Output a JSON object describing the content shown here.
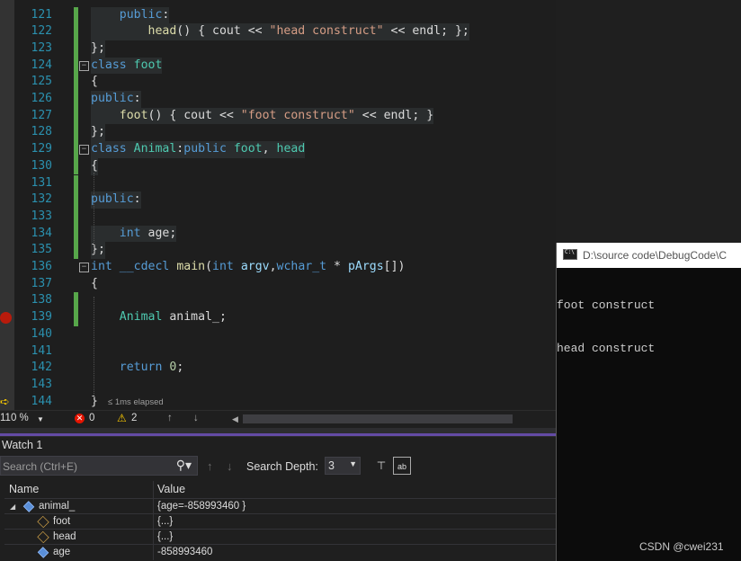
{
  "editor": {
    "lines": [
      {
        "n": "121",
        "t": [
          [
            "    ",
            ""
          ],
          [
            "public",
            "kw"
          ],
          [
            ":",
            ""
          ]
        ]
      },
      {
        "n": "122",
        "t": [
          [
            "        ",
            ""
          ],
          [
            "head",
            "fn"
          ],
          [
            "() { ",
            ""
          ],
          [
            "cout",
            "id"
          ],
          [
            " << ",
            ""
          ],
          [
            "\"head construct\"",
            "str"
          ],
          [
            " << ",
            ""
          ],
          [
            "endl",
            "id"
          ],
          [
            "; };",
            ""
          ]
        ]
      },
      {
        "n": "123",
        "t": [
          [
            "};",
            ""
          ]
        ]
      },
      {
        "n": "124",
        "t": [
          [
            "class",
            "kw"
          ],
          [
            " ",
            ""
          ],
          [
            "foot",
            "ty"
          ]
        ],
        "fold": "-"
      },
      {
        "n": "125",
        "t": [
          [
            "{",
            ""
          ]
        ]
      },
      {
        "n": "126",
        "t": [
          [
            "public",
            "kw"
          ],
          [
            ":",
            ""
          ]
        ]
      },
      {
        "n": "127",
        "t": [
          [
            "    ",
            ""
          ],
          [
            "foot",
            "fn"
          ],
          [
            "() { ",
            ""
          ],
          [
            "cout",
            "id"
          ],
          [
            " << ",
            ""
          ],
          [
            "\"foot construct\"",
            "str"
          ],
          [
            " << ",
            ""
          ],
          [
            "endl",
            "id"
          ],
          [
            "; }",
            ""
          ]
        ]
      },
      {
        "n": "128",
        "t": [
          [
            "};",
            ""
          ]
        ]
      },
      {
        "n": "129",
        "t": [
          [
            "class",
            "kw"
          ],
          [
            " ",
            ""
          ],
          [
            "Animal",
            "ty"
          ],
          [
            ":",
            ""
          ],
          [
            "public",
            "kw"
          ],
          [
            " ",
            ""
          ],
          [
            "foot",
            "ty"
          ],
          [
            ", ",
            ""
          ],
          [
            "head",
            "ty"
          ]
        ],
        "fold": "-"
      },
      {
        "n": "130",
        "t": [
          [
            "{",
            ""
          ]
        ]
      },
      {
        "n": "131",
        "t": [
          [
            "",
            ""
          ]
        ]
      },
      {
        "n": "132",
        "t": [
          [
            "public",
            "kw"
          ],
          [
            ":",
            ""
          ]
        ]
      },
      {
        "n": "133",
        "t": [
          [
            "",
            ""
          ]
        ]
      },
      {
        "n": "134",
        "t": [
          [
            "    ",
            ""
          ],
          [
            "int",
            "kw"
          ],
          [
            " ",
            ""
          ],
          [
            "age",
            "id"
          ],
          [
            ";",
            ""
          ]
        ]
      },
      {
        "n": "135",
        "t": [
          [
            "};",
            ""
          ]
        ]
      },
      {
        "n": "136",
        "t": [
          [
            "int",
            "kw"
          ],
          [
            " ",
            ""
          ],
          [
            "__cdecl",
            "kw"
          ],
          [
            " ",
            ""
          ],
          [
            "main",
            "fn"
          ],
          [
            "(",
            ""
          ],
          [
            "int",
            "kw"
          ],
          [
            " ",
            ""
          ],
          [
            "argv",
            "par"
          ],
          [
            ",",
            ""
          ],
          [
            "wchar_t",
            "kw"
          ],
          [
            " * ",
            ""
          ],
          [
            "pArgs",
            "par"
          ],
          [
            "[])",
            ""
          ]
        ],
        "fold": "-"
      },
      {
        "n": "137",
        "t": [
          [
            "{",
            ""
          ]
        ]
      },
      {
        "n": "138",
        "t": [
          [
            "",
            ""
          ]
        ]
      },
      {
        "n": "139",
        "t": [
          [
            "    ",
            ""
          ],
          [
            "Animal",
            "ty"
          ],
          [
            " ",
            ""
          ],
          [
            "animal_",
            "id"
          ],
          [
            ";",
            ""
          ]
        ]
      },
      {
        "n": "140",
        "t": [
          [
            "",
            ""
          ]
        ]
      },
      {
        "n": "141",
        "t": [
          [
            "",
            ""
          ]
        ]
      },
      {
        "n": "142",
        "t": [
          [
            "    ",
            ""
          ],
          [
            "return",
            "kw"
          ],
          [
            " ",
            ""
          ],
          [
            "0",
            "num"
          ],
          [
            ";",
            ""
          ]
        ]
      },
      {
        "n": "143",
        "t": [
          [
            "",
            ""
          ]
        ]
      },
      {
        "n": "144",
        "t": [
          [
            "}",
            ""
          ]
        ]
      }
    ],
    "elapsed": "≤ 1ms elapsed"
  },
  "status": {
    "zoom": "110 %",
    "errors": "0",
    "warnings": "2"
  },
  "watch": {
    "title": "Watch 1",
    "search_placeholder": "Search (Ctrl+E)",
    "depth_label": "Search Depth:",
    "depth_value": "3",
    "col_name": "Name",
    "col_value": "Value",
    "rows": [
      {
        "name": "animal_",
        "value": "{age=-858993460 }",
        "icon": "object-icon"
      },
      {
        "name": "foot",
        "value": "{...}",
        "icon": "base-class-icon"
      },
      {
        "name": "head",
        "value": "{...}",
        "icon": "base-class-icon"
      },
      {
        "name": "age",
        "value": "-858993460",
        "icon": "field-icon"
      }
    ]
  },
  "console": {
    "title": "D:\\source code\\DebugCode\\C",
    "output": [
      "foot construct",
      "head construct"
    ]
  },
  "watermark": "CSDN @cwei231",
  "colors": {
    "keyword": "#569cd6",
    "type": "#4ec9b0",
    "function": "#dcdcaa",
    "string": "#d69d85",
    "linenum": "#2b91af",
    "accent": "#6a4fb3"
  }
}
